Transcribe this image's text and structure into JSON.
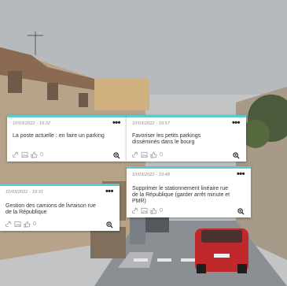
{
  "cards": [
    {
      "date": "10/03/2022 - 19:32",
      "text": "La poste actuelle : en faire un parking",
      "likes": "0"
    },
    {
      "date": "10/03/2022 - 19:57",
      "text": "Favoriser les petits parkings disséminés dans le bourg",
      "likes": "0"
    },
    {
      "date": "10/03/2022 - 19:48",
      "text": "Supprimer le stationnement linéaire rue de la République (garder arrêt minute et PMR)",
      "likes": "0"
    },
    {
      "date": "10/03/2022 - 19:31",
      "text": "Gestion des camions de livraison rue de la République",
      "likes": "0"
    }
  ],
  "ui": {
    "more_label": "•••"
  },
  "colors": {
    "accent": "#5fc8cf",
    "sky": "#b9bcbf",
    "car": "#c0292b"
  }
}
